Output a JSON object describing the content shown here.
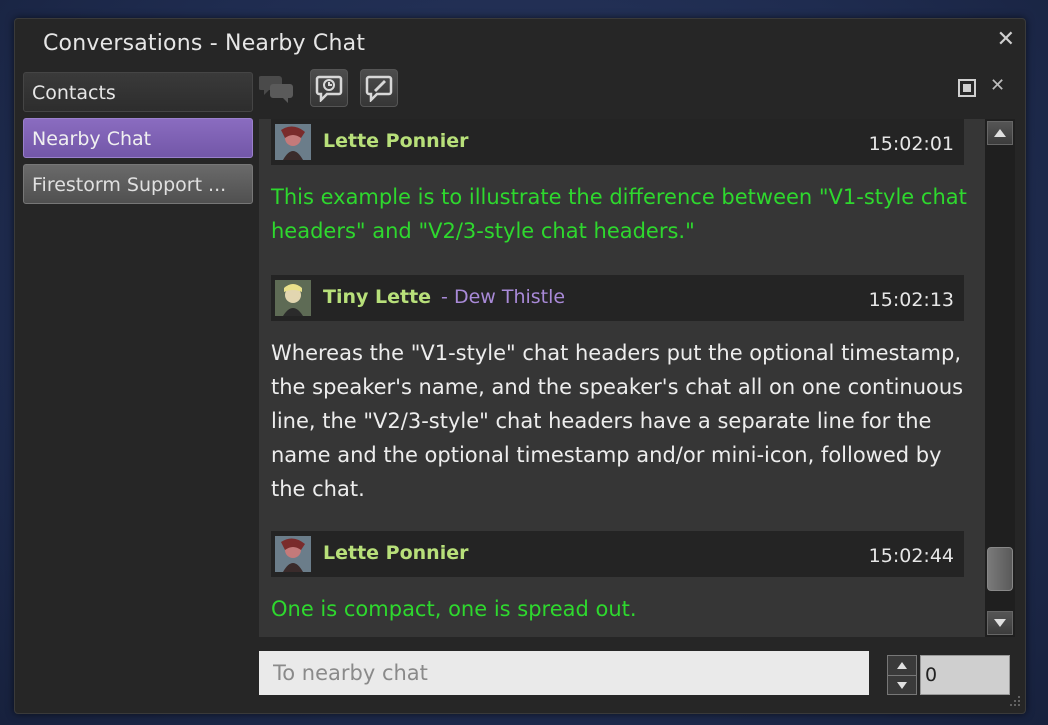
{
  "window": {
    "title": "Conversations - Nearby Chat",
    "close_glyph": "✕"
  },
  "sidebar": {
    "contacts_label": "Contacts",
    "tabs": [
      {
        "label": "Nearby Chat",
        "active": true
      },
      {
        "label": "Firestorm Support ...",
        "active": false
      }
    ]
  },
  "toolbar": {
    "icons": [
      "speakers-icon",
      "chat-bubble-clock-icon",
      "chat-bubble-edit-icon",
      "tear-off-icon",
      "close-icon"
    ],
    "close_glyph": "✕"
  },
  "messages": [
    {
      "name": "Lette Ponnier",
      "alias": "",
      "time": "15:02:01",
      "text": "This example is to illustrate the difference between \"V1-style chat headers\" and \"V2/3-style chat headers.\"",
      "color": "#2ed82e"
    },
    {
      "name": "Tiny Lette",
      "alias": "- Dew Thistle",
      "time": "15:02:13",
      "text": "Whereas the \"V1-style\" chat headers put the optional timestamp, the speaker's name, and the speaker's chat all on one continuous line, the \"V2/3-style\" chat headers have a separate line for the name and the optional timestamp and/or mini-icon, followed by the chat.",
      "color": "#ededed"
    },
    {
      "name": "Lette Ponnier",
      "alias": "",
      "time": "15:02:44",
      "text": "One is compact, one is spread out.",
      "color": "#2ed82e"
    }
  ],
  "input": {
    "placeholder": "To nearby chat",
    "value": ""
  },
  "channel": {
    "value": "0"
  },
  "colors": {
    "active_tab": "#7e62b6",
    "name_color": "#b8e07a",
    "alias_color": "#a98ad8",
    "own_chat_color": "#2ed82e",
    "other_chat_color": "#ededed"
  }
}
